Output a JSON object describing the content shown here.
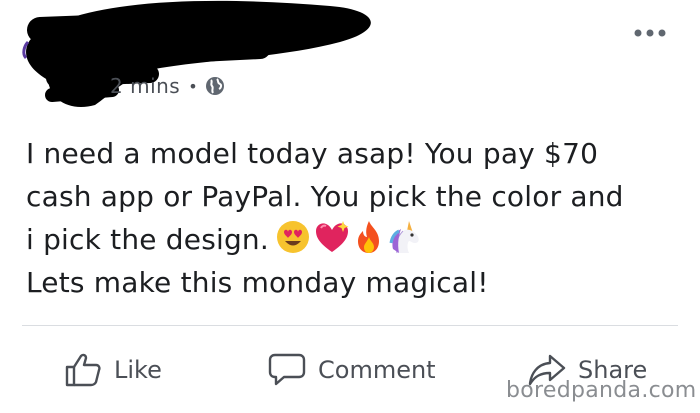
{
  "post": {
    "timestamp": "2 mins",
    "separator": "•",
    "privacy_icon": "globe-icon",
    "more_icon": "more-options-icon",
    "text_lines": [
      "I need a model today asap! You pay $70",
      "cash app or PayPal. You pick the color and",
      "i pick the design.",
      "Lets make this monday magical!"
    ],
    "emojis": [
      "heart-eyes-emoji",
      "sparkling-heart-emoji",
      "fire-emoji",
      "unicorn-emoji"
    ]
  },
  "actions": {
    "like_label": "Like",
    "comment_label": "Comment",
    "share_label": "Share"
  },
  "watermark": "boredpanda.com",
  "colors": {
    "text": "#1c1e21",
    "secondary_text": "#4b4f56",
    "divider": "#dadde1",
    "redaction": "#000000"
  }
}
